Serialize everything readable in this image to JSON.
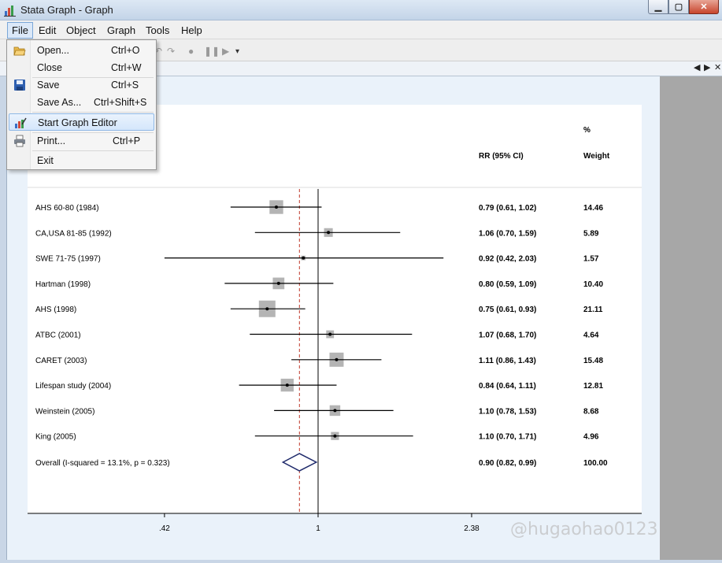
{
  "window": {
    "title": "Stata Graph - Graph"
  },
  "menubar": {
    "items": [
      "File",
      "Edit",
      "Object",
      "Graph",
      "Tools",
      "Help"
    ]
  },
  "file_menu": {
    "items": [
      {
        "label": "Open...",
        "shortcut": "Ctrl+O",
        "icon": "open-folder-icon"
      },
      {
        "label": "Close",
        "shortcut": "Ctrl+W"
      },
      {
        "label": "Save",
        "shortcut": "Ctrl+S",
        "icon": "save-icon"
      },
      {
        "label": "Save As...",
        "shortcut": "Ctrl+Shift+S"
      },
      {
        "label": "Start Graph Editor",
        "shortcut": "",
        "icon": "graph-editor-icon",
        "highlighted": true
      },
      {
        "label": "Print...",
        "shortcut": "Ctrl+P",
        "icon": "printer-icon"
      },
      {
        "label": "Exit",
        "shortcut": ""
      }
    ]
  },
  "tab_nav": {
    "prev": "◀",
    "next": "▶",
    "close": "✕"
  },
  "chart_data": {
    "type": "forest",
    "columns": {
      "effect_header": "RR (95% CI)",
      "weight_header_line1": "%",
      "weight_header_line2": "Weight"
    },
    "null_line": 1,
    "overall_line": 0.9,
    "x_ticks": [
      ".42",
      "1",
      "2.38"
    ],
    "x_tick_values": [
      0.42,
      1,
      2.38
    ],
    "studies": [
      {
        "label": "AHS 60-80 (1984)",
        "rr": 0.79,
        "lo": 0.61,
        "hi": 1.02,
        "ci_text": "0.79 (0.61, 1.02)",
        "weight": "14.46"
      },
      {
        "label": "CA,USA 81-85 (1992)",
        "rr": 1.06,
        "lo": 0.7,
        "hi": 1.59,
        "ci_text": "1.06 (0.70, 1.59)",
        "weight": "5.89"
      },
      {
        "label": "SWE 71-75 (1997)",
        "rr": 0.92,
        "lo": 0.42,
        "hi": 2.03,
        "ci_text": "0.92 (0.42, 2.03)",
        "weight": "1.57"
      },
      {
        "label": "Hartman (1998)",
        "rr": 0.8,
        "lo": 0.59,
        "hi": 1.09,
        "ci_text": "0.80 (0.59, 1.09)",
        "weight": "10.40"
      },
      {
        "label": "AHS (1998)",
        "rr": 0.75,
        "lo": 0.61,
        "hi": 0.93,
        "ci_text": "0.75 (0.61, 0.93)",
        "weight": "21.11"
      },
      {
        "label": "ATBC (2001)",
        "rr": 1.07,
        "lo": 0.68,
        "hi": 1.7,
        "ci_text": "1.07 (0.68, 1.70)",
        "weight": "4.64"
      },
      {
        "label": "CARET (2003)",
        "rr": 1.11,
        "lo": 0.86,
        "hi": 1.43,
        "ci_text": "1.11 (0.86, 1.43)",
        "weight": "15.48"
      },
      {
        "label": "Lifespan study (2004)",
        "rr": 0.84,
        "lo": 0.64,
        "hi": 1.11,
        "ci_text": "0.84 (0.64, 1.11)",
        "weight": "12.81"
      },
      {
        "label": "Weinstein (2005)",
        "rr": 1.1,
        "lo": 0.78,
        "hi": 1.53,
        "ci_text": "1.10 (0.78, 1.53)",
        "weight": "8.68"
      },
      {
        "label": "King (2005)",
        "rr": 1.1,
        "lo": 0.7,
        "hi": 1.71,
        "ci_text": "1.10 (0.70, 1.71)",
        "weight": "4.96"
      }
    ],
    "overall": {
      "label": "Overall  (I-squared = 13.1%, p = 0.323)",
      "rr": 0.9,
      "lo": 0.82,
      "hi": 0.99,
      "ci_text": "0.90 (0.82, 0.99)",
      "weight": "100.00"
    },
    "colors": {
      "box": "#b4b4b4",
      "line": "#000000",
      "null": "#000000",
      "overall_line": "#c0392b",
      "diamond": "#1f2a6b"
    }
  },
  "watermark": "@hugaohao0123"
}
